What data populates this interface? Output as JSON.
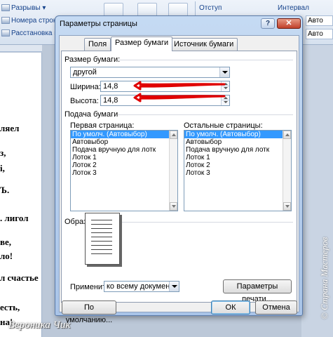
{
  "ribbon": {
    "breaks": "Разрывы",
    "line_numbers": "Номера строк",
    "hyphenation": "Расстановка пе",
    "indent_group": "Отступ",
    "spacing_group": "Интервал",
    "auto1": "Авто",
    "auto2": "Авто"
  },
  "document_lines": [
    "ляел",
    "з,",
    "i,",
    "Ъ.",
    ". лигол",
    "ве,",
    "ло!",
    "л счастье",
    "есть,",
    "на!"
  ],
  "dialog": {
    "title": "Параметры страницы",
    "help": "?",
    "close": "✕",
    "tabs": [
      "Поля",
      "Размер бумаги",
      "Источник бумаги"
    ],
    "paper_size": {
      "group_label": "Размер бумаги:",
      "selected": "другой",
      "width_label": "Ширина:",
      "width_value": "14,8",
      "height_label": "Высота:",
      "height_value": "14,8"
    },
    "paper_source": {
      "group_label": "Подача бумаги",
      "first_page_label": "Первая страница:",
      "other_pages_label": "Остальные страницы:",
      "first_page_items": [
        "По умолч. (Автовыбор)",
        "Автовыбор",
        "Подача вручную для лотк",
        "Лоток 1",
        "Лоток 2",
        "Лоток 3"
      ],
      "other_pages_items": [
        "По умолч. (Автовыбор)",
        "Автовыбор",
        "Подача вручную для лотк",
        "Лоток 1",
        "Лоток 2",
        "Лоток 3"
      ],
      "selected_index": 0
    },
    "preview": {
      "group_label": "Образец",
      "apply_label": "Применить:",
      "apply_value": "ко всему документу",
      "print_options": "Параметры печати..."
    },
    "buttons": {
      "default": "По умолчанию...",
      "ok": "ОК",
      "cancel": "Отмена"
    }
  },
  "watermark": {
    "author": "Вероника Чик",
    "site": "© Страна Мастеров"
  },
  "colors": {
    "selection": "#3399ff",
    "annotation": "#e00000"
  }
}
